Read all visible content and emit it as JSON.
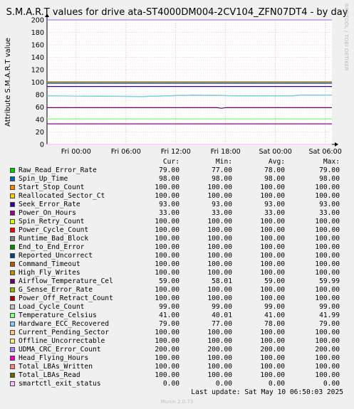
{
  "title": "S.M.A.R.T values for drive ata-ST4000DM004-2CV104_ZFN07DT4 - by day",
  "watermark": "RRDTOOL / TOBI OETIKER",
  "footer": {
    "last_update": "Last update:  Sat May 10 06:50:03 2025",
    "version": "Munin 2.0.73"
  },
  "legend_headers": {
    "cur": "Cur:",
    "min": "Min:",
    "avg": "Avg:",
    "max": "Max:"
  },
  "chart_data": {
    "type": "line",
    "title": "S.M.A.R.T values for drive ata-ST4000DM004-2CV104_ZFN07DT4 - by day",
    "ylabel": "Attribute S.M.A.R.T value",
    "ylim": [
      0,
      200
    ],
    "yticks": [
      0,
      20,
      40,
      60,
      80,
      100,
      120,
      140,
      160,
      180,
      200
    ],
    "xticks": [
      "Fri 00:00",
      "Fri 06:00",
      "Fri 12:00",
      "Fri 18:00",
      "Sat 00:00",
      "Sat 06:00"
    ],
    "x_range_hours": [
      -3.5,
      30.8
    ],
    "grid": true,
    "series": [
      {
        "name": "Raw_Read_Error_Rate",
        "color": "#00cc00",
        "cur": "79.00",
        "min": "77.00",
        "avg": "78.00",
        "max": "79.00",
        "values": [
          [
            -3.5,
            78
          ],
          [
            8,
            77
          ],
          [
            14,
            79
          ],
          [
            20,
            78
          ],
          [
            26,
            78
          ],
          [
            27,
            79
          ],
          [
            30.8,
            79
          ]
        ]
      },
      {
        "name": "Spin_Up_Time",
        "color": "#0066b3",
        "cur": "98.00",
        "min": "98.00",
        "avg": "98.00",
        "max": "98.00",
        "values": [
          [
            -3.5,
            98
          ],
          [
            30.8,
            98
          ]
        ]
      },
      {
        "name": "Start_Stop_Count",
        "color": "#ff8000",
        "cur": "100.00",
        "min": "100.00",
        "avg": "100.00",
        "max": "100.00",
        "values": [
          [
            -3.5,
            100
          ],
          [
            30.8,
            100
          ]
        ]
      },
      {
        "name": "Reallocated_Sector_Ct",
        "color": "#ffcc00",
        "cur": "100.00",
        "min": "100.00",
        "avg": "100.00",
        "max": "100.00",
        "values": [
          [
            -3.5,
            100
          ],
          [
            30.8,
            100
          ]
        ]
      },
      {
        "name": "Seek_Error_Rate",
        "color": "#330099",
        "cur": "93.00",
        "min": "93.00",
        "avg": "93.00",
        "max": "93.00",
        "values": [
          [
            -3.5,
            93
          ],
          [
            30.8,
            93
          ]
        ]
      },
      {
        "name": "Power_On_Hours",
        "color": "#990099",
        "cur": "33.00",
        "min": "33.00",
        "avg": "33.00",
        "max": "33.00",
        "values": [
          [
            -3.5,
            33
          ],
          [
            30.8,
            33
          ]
        ]
      },
      {
        "name": "Spin_Retry_Count",
        "color": "#ccff00",
        "cur": "100.00",
        "min": "100.00",
        "avg": "100.00",
        "max": "100.00",
        "values": [
          [
            -3.5,
            100
          ],
          [
            30.8,
            100
          ]
        ]
      },
      {
        "name": "Power_Cycle_Count",
        "color": "#ff0000",
        "cur": "100.00",
        "min": "100.00",
        "avg": "100.00",
        "max": "100.00",
        "values": [
          [
            -3.5,
            100
          ],
          [
            30.8,
            100
          ]
        ]
      },
      {
        "name": "Runtime_Bad_Block",
        "color": "#808080",
        "cur": "100.00",
        "min": "100.00",
        "avg": "100.00",
        "max": "100.00",
        "values": [
          [
            -3.5,
            100
          ],
          [
            30.8,
            100
          ]
        ]
      },
      {
        "name": "End_to_End_Error",
        "color": "#008f00",
        "cur": "100.00",
        "min": "100.00",
        "avg": "100.00",
        "max": "100.00",
        "values": [
          [
            -3.5,
            100
          ],
          [
            30.8,
            100
          ]
        ]
      },
      {
        "name": "Reported_Uncorrect",
        "color": "#00487d",
        "cur": "100.00",
        "min": "100.00",
        "avg": "100.00",
        "max": "100.00",
        "values": [
          [
            -3.5,
            100
          ],
          [
            30.8,
            100
          ]
        ]
      },
      {
        "name": "Command_Timeout",
        "color": "#b35a00",
        "cur": "100.00",
        "min": "100.00",
        "avg": "100.00",
        "max": "100.00",
        "values": [
          [
            -3.5,
            100
          ],
          [
            30.8,
            100
          ]
        ]
      },
      {
        "name": "High_Fly_Writes",
        "color": "#b38f00",
        "cur": "100.00",
        "min": "100.00",
        "avg": "100.00",
        "max": "100.00",
        "values": [
          [
            -3.5,
            100
          ],
          [
            30.8,
            100
          ]
        ]
      },
      {
        "name": "Airflow_Temperature_Cel",
        "color": "#6b006b",
        "cur": "59.00",
        "min": "58.01",
        "avg": "59.00",
        "max": "59.99",
        "values": [
          [
            -3.5,
            59
          ],
          [
            17,
            59
          ],
          [
            17.5,
            58.01
          ],
          [
            18,
            59
          ],
          [
            30.8,
            59
          ]
        ]
      },
      {
        "name": "G_Sense_Error_Rate",
        "color": "#8fb300",
        "cur": "100.00",
        "min": "100.00",
        "avg": "100.00",
        "max": "100.00",
        "values": [
          [
            -3.5,
            100
          ],
          [
            30.8,
            100
          ]
        ]
      },
      {
        "name": "Power_Off_Retract_Count",
        "color": "#b30000",
        "cur": "100.00",
        "min": "100.00",
        "avg": "100.00",
        "max": "100.00",
        "values": [
          [
            -3.5,
            100
          ],
          [
            30.8,
            100
          ]
        ]
      },
      {
        "name": "Load_Cycle_Count",
        "color": "#bebebe",
        "cur": "99.00",
        "min": "99.00",
        "avg": "99.00",
        "max": "99.00",
        "values": [
          [
            -3.5,
            99
          ],
          [
            30.8,
            99
          ]
        ]
      },
      {
        "name": "Temperature_Celsius",
        "color": "#80ff80",
        "cur": "41.00",
        "min": "40.01",
        "avg": "41.00",
        "max": "41.99",
        "values": [
          [
            -3.5,
            41
          ],
          [
            30.8,
            41
          ]
        ]
      },
      {
        "name": "Hardware_ECC_Recovered",
        "color": "#80c9ff",
        "cur": "79.00",
        "min": "77.00",
        "avg": "78.00",
        "max": "79.00",
        "values": [
          [
            -3.5,
            78
          ],
          [
            8,
            77
          ],
          [
            14,
            79
          ],
          [
            20,
            78
          ],
          [
            26,
            78
          ],
          [
            27,
            79
          ],
          [
            30.8,
            79
          ]
        ]
      },
      {
        "name": "Current_Pending_Sector",
        "color": "#ffc080",
        "cur": "100.00",
        "min": "100.00",
        "avg": "100.00",
        "max": "100.00",
        "values": [
          [
            -3.5,
            100
          ],
          [
            30.8,
            100
          ]
        ]
      },
      {
        "name": "Offline_Uncorrectable",
        "color": "#ffe680",
        "cur": "100.00",
        "min": "100.00",
        "avg": "100.00",
        "max": "100.00",
        "values": [
          [
            -3.5,
            100
          ],
          [
            30.8,
            100
          ]
        ]
      },
      {
        "name": "UDMA_CRC_Error_Count",
        "color": "#aa80ff",
        "cur": "200.00",
        "min": "200.00",
        "avg": "200.00",
        "max": "200.00",
        "values": [
          [
            -3.5,
            200
          ],
          [
            30.8,
            200
          ]
        ]
      },
      {
        "name": "Head_Flying_Hours",
        "color": "#ee00cc",
        "cur": "100.00",
        "min": "100.00",
        "avg": "100.00",
        "max": "100.00",
        "values": [
          [
            -3.5,
            100
          ],
          [
            30.8,
            100
          ]
        ]
      },
      {
        "name": "Total_LBAs_Written",
        "color": "#ff8080",
        "cur": "100.00",
        "min": "100.00",
        "avg": "100.00",
        "max": "100.00",
        "values": [
          [
            -3.5,
            100
          ],
          [
            30.8,
            100
          ]
        ]
      },
      {
        "name": "Total_LBAs_Read",
        "color": "#666600",
        "cur": "100.00",
        "min": "100.00",
        "avg": "100.00",
        "max": "100.00",
        "values": [
          [
            -3.5,
            100
          ],
          [
            30.8,
            100
          ]
        ]
      },
      {
        "name": "smartctl_exit_status",
        "color": "#ffbfff",
        "cur": "0.00",
        "min": "0.00",
        "avg": "0.00",
        "max": "0.00",
        "values": [
          [
            -3.5,
            0
          ],
          [
            30.8,
            0
          ]
        ]
      }
    ]
  }
}
